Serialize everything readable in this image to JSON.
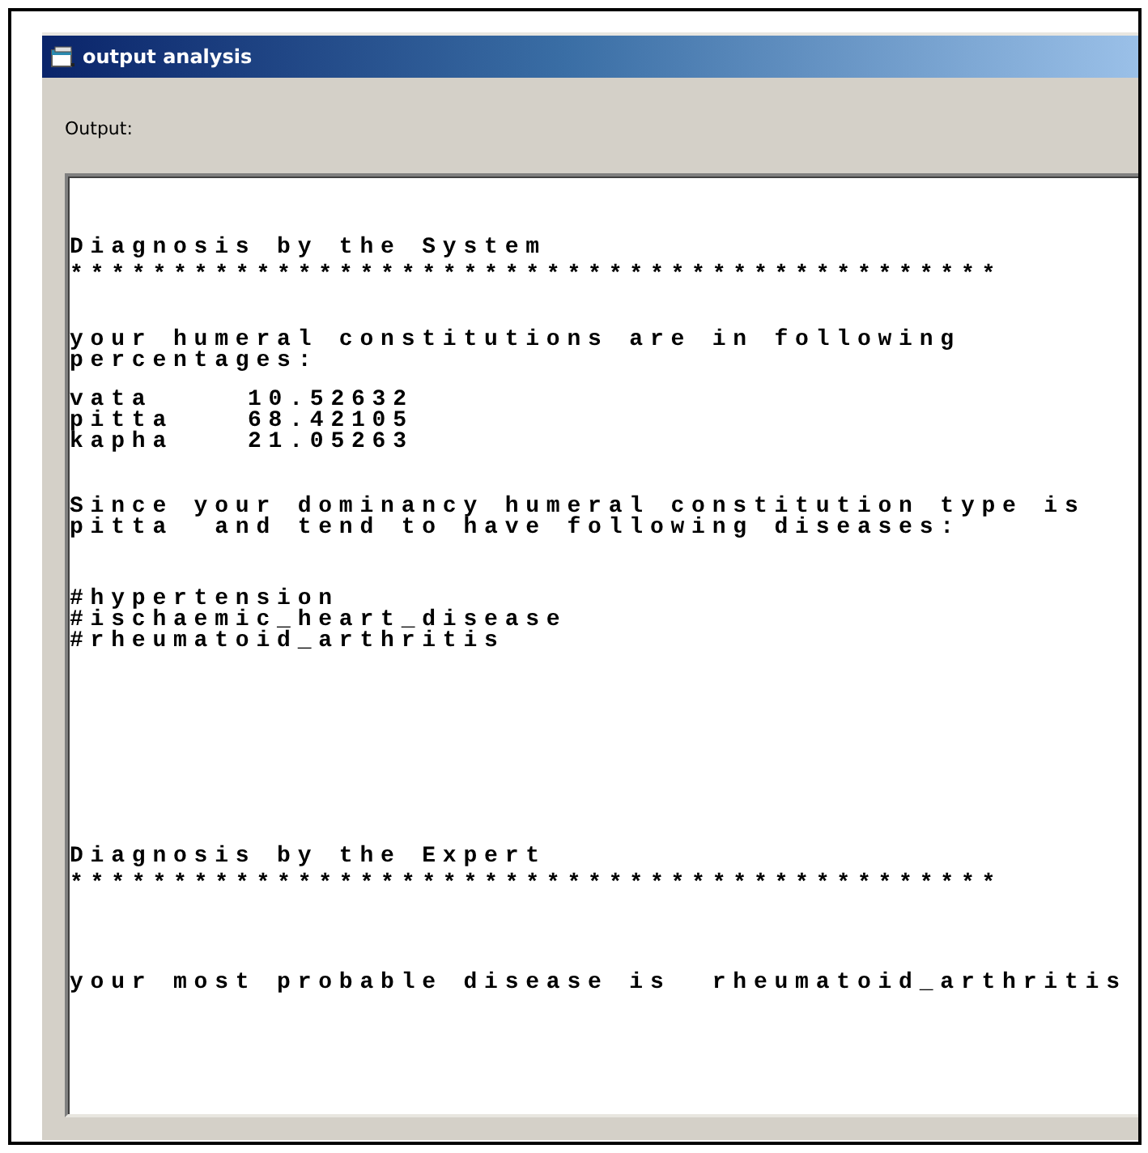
{
  "window": {
    "title": "output analysis"
  },
  "output": {
    "label": "Output:",
    "blocks": [
      {
        "kind": "heading",
        "lines": [
          "Diagnosis by the System"
        ]
      },
      {
        "kind": "rule",
        "lines": [
          "*********************************************"
        ]
      },
      {
        "kind": "paragraph",
        "lines": [
          "your humeral constitutions are in following",
          "percentages:"
        ]
      },
      {
        "kind": "table",
        "rows": [
          {
            "name": "vata",
            "value": "10.52632"
          },
          {
            "name": "pitta",
            "value": "68.42105"
          },
          {
            "name": "kapha",
            "value": "21.05263"
          }
        ]
      },
      {
        "kind": "paragraph",
        "lines": [
          "Since your dominancy humeral constitution type is",
          "pitta  and tend to have following diseases:"
        ]
      },
      {
        "kind": "list",
        "lines": [
          "#hypertension",
          "#ischaemic_heart_disease",
          "#rheumatoid_arthritis"
        ]
      },
      {
        "kind": "heading",
        "lines": [
          "Diagnosis by the Expert"
        ]
      },
      {
        "kind": "rule",
        "lines": [
          "*********************************************"
        ]
      },
      {
        "kind": "result",
        "lines": [
          "your most probable disease is  rheumatoid_arthritis"
        ]
      }
    ]
  }
}
